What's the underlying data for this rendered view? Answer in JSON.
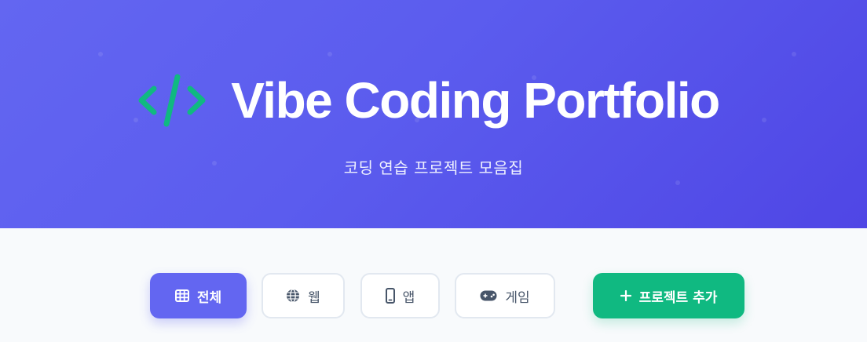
{
  "header": {
    "title": "Vibe Coding Portfolio",
    "subtitle": "코딩 연습 프로젝트 모음집",
    "logo_icon": "code-icon",
    "background_color": "#5b5cee",
    "logo_color": "#10b981"
  },
  "filters": {
    "items": [
      {
        "label": "전체",
        "icon": "grid-icon",
        "active": true
      },
      {
        "label": "웹",
        "icon": "globe-icon",
        "active": false
      },
      {
        "label": "앱",
        "icon": "mobile-icon",
        "active": false
      },
      {
        "label": "게임",
        "icon": "gamepad-icon",
        "active": false
      }
    ],
    "active_color": "#6366f1"
  },
  "actions": {
    "add_project_label": "프로젝트 추가",
    "add_icon": "plus-icon",
    "add_color": "#10b981"
  }
}
